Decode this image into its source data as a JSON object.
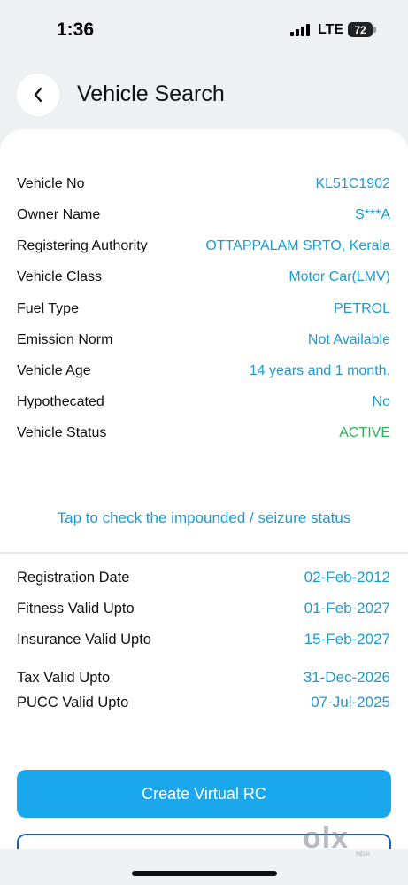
{
  "status_bar": {
    "time": "1:36",
    "network": "LTE",
    "battery": "72"
  },
  "header": {
    "title": "Vehicle Search"
  },
  "vehicle_details": [
    {
      "label": "Vehicle No",
      "value": "KL51C1902"
    },
    {
      "label": "Owner Name",
      "value": "S***A"
    },
    {
      "label": "Registering Authority",
      "value": "OTTAPPALAM SRTO, Kerala"
    },
    {
      "label": "Vehicle Class",
      "value": "Motor Car(LMV)"
    },
    {
      "label": "Fuel Type",
      "value": "PETROL"
    },
    {
      "label": "Emission Norm",
      "value": "Not Available"
    },
    {
      "label": "Vehicle Age",
      "value": "14 years and 1 month."
    },
    {
      "label": "Hypothecated",
      "value": "No"
    },
    {
      "label": "Vehicle Status",
      "value": "ACTIVE"
    }
  ],
  "seizure_link": "Tap to check the impounded / seizure status",
  "validity": [
    {
      "label": "Registration Date",
      "value": "02-Feb-2012"
    },
    {
      "label": "Fitness Valid Upto",
      "value": "01-Feb-2027"
    },
    {
      "label": "Insurance Valid Upto",
      "value": "15-Feb-2027"
    },
    {
      "label": "Tax Valid Upto",
      "value": "31-Dec-2026"
    },
    {
      "label": "PUCC Valid Upto",
      "value": "07-Jul-2025"
    }
  ],
  "actions": {
    "create_rc": "Create Virtual RC"
  },
  "watermark": {
    "text": "olx",
    "sub": "INDIA"
  },
  "colors": {
    "accent": "#1a9bd7",
    "button": "#1aa7ec",
    "active": "#2fb35a"
  }
}
